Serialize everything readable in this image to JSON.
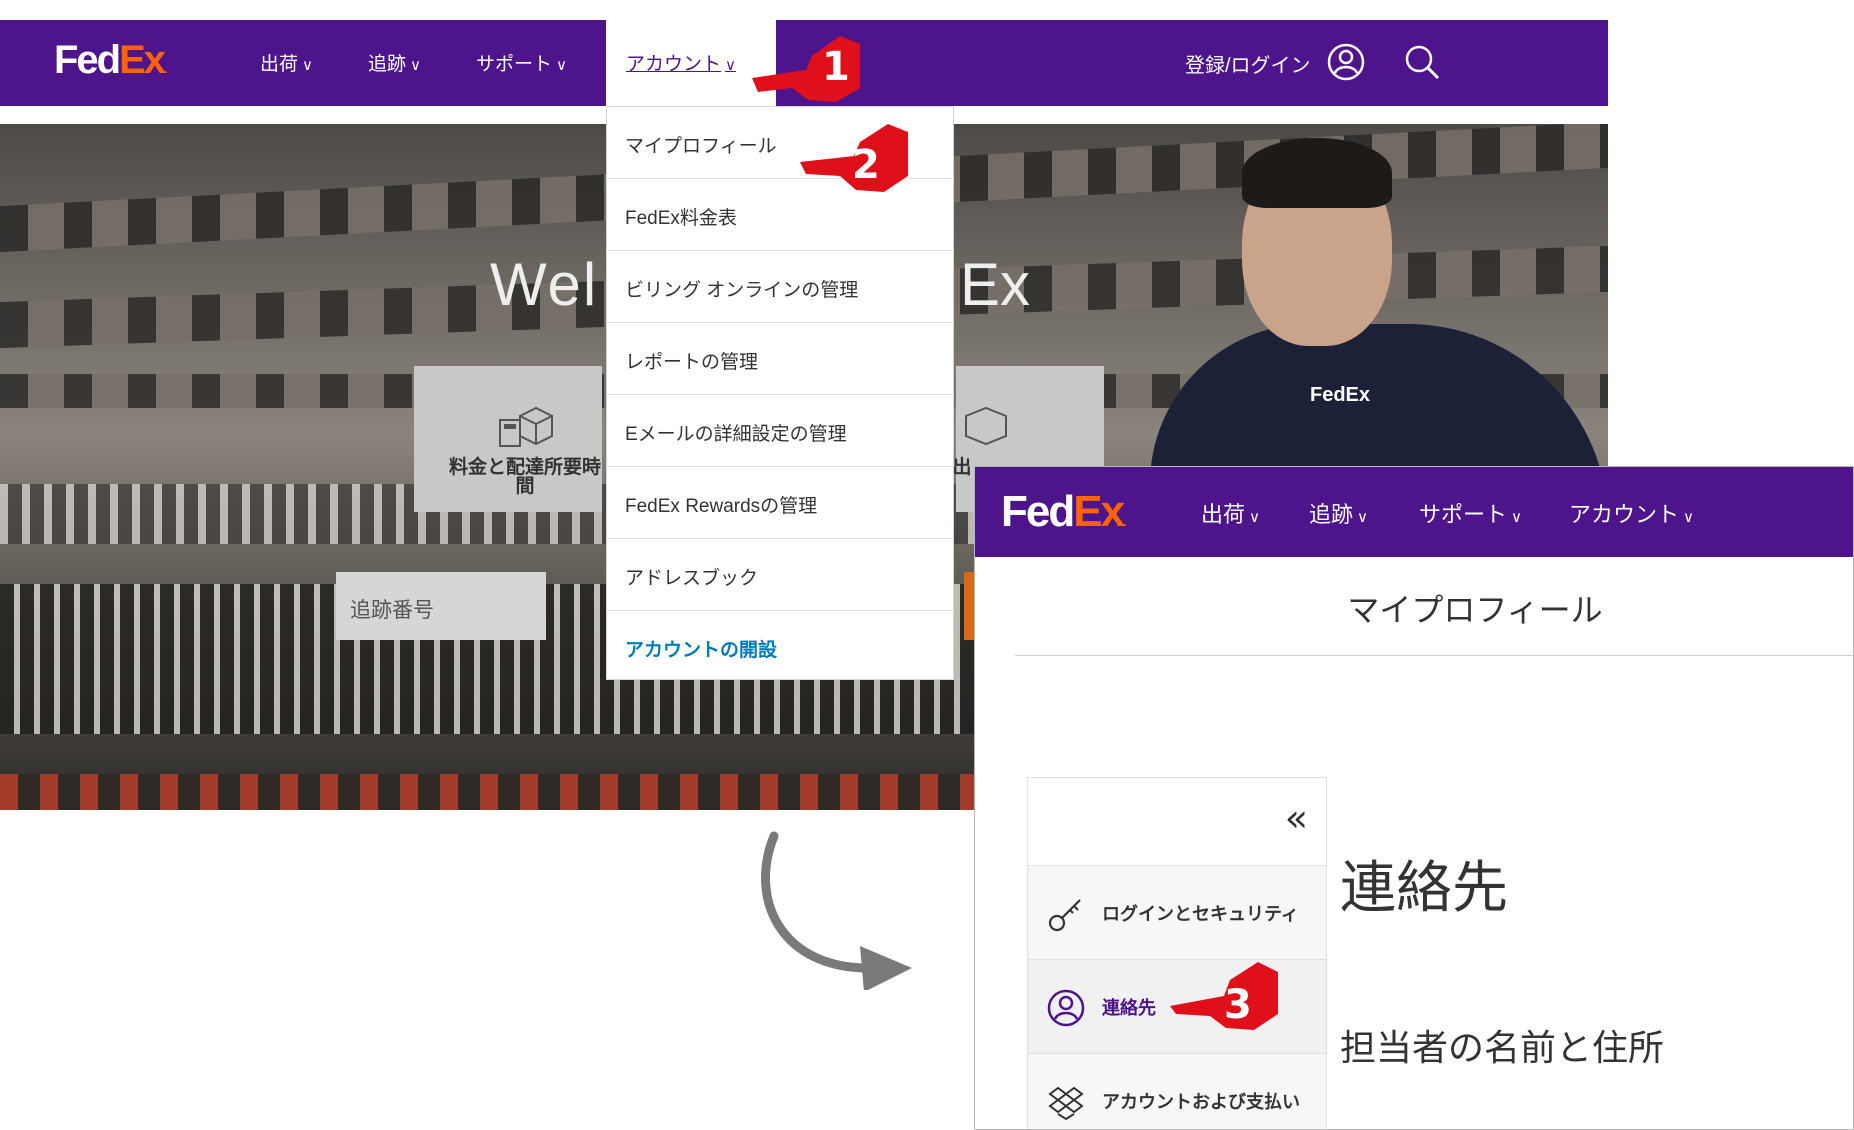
{
  "colors": {
    "brand_purple": "#4d148c",
    "brand_orange": "#ff6200",
    "link_blue": "#007ab7",
    "pointer_red": "#e0101a"
  },
  "screenshot1": {
    "logo": {
      "fed": "Fed",
      "ex": "Ex"
    },
    "nav": {
      "items": [
        {
          "label": "出荷"
        },
        {
          "label": "追跡"
        },
        {
          "label": "サポート"
        },
        {
          "label": "アカウント"
        }
      ],
      "login_label": "登録/ログイン"
    },
    "hero": {
      "welcome_left": "Wel",
      "welcome_right": "Ex",
      "card1_label": "料金と配達所要時間",
      "card2_label": "出",
      "tracking_placeholder": "追跡番号"
    },
    "dropdown": {
      "items": [
        {
          "label": "マイプロフィール"
        },
        {
          "label": "FedEx料金表"
        },
        {
          "label": "ビリング オンラインの管理"
        },
        {
          "label": "レポートの管理"
        },
        {
          "label": "Eメールの詳細設定の管理"
        },
        {
          "label": "FedEx Rewardsの管理"
        },
        {
          "label": "アドレスブック"
        },
        {
          "label": "アカウントの開設"
        }
      ]
    }
  },
  "screenshot2": {
    "logo": {
      "fed": "Fed",
      "ex": "Ex"
    },
    "nav": {
      "items": [
        {
          "label": "出荷"
        },
        {
          "label": "追跡"
        },
        {
          "label": "サポート"
        },
        {
          "label": "アカウント"
        }
      ]
    },
    "page_title": "マイプロフィール",
    "sidebar": {
      "collapse_glyph": "«",
      "items": [
        {
          "label": "ログインとセキュリティ",
          "icon": "key-icon"
        },
        {
          "label": "連絡先",
          "icon": "user-icon"
        },
        {
          "label": "アカウントおよび支払い",
          "icon": "dropbox-icon"
        }
      ]
    },
    "content": {
      "heading": "連絡先",
      "subheading": "担当者の名前と住所"
    }
  },
  "annotations": {
    "steps": [
      "1",
      "2",
      "3"
    ]
  }
}
